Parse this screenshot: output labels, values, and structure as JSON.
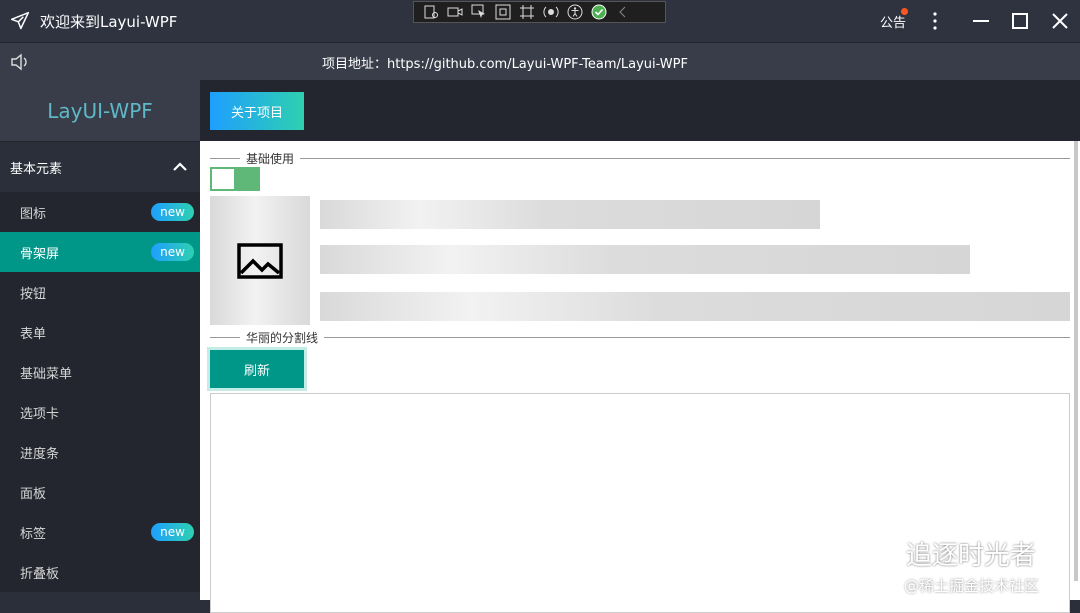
{
  "window": {
    "title": "欢迎来到Layui-WPF",
    "notice_label": "公告"
  },
  "subbar": {
    "address_label": "项目地址：https://github.com/Layui-WPF-Team/Layui-WPF"
  },
  "sidebar": {
    "brand": "LayUI-WPF",
    "group_label": "基本元素",
    "items": [
      {
        "label": "图标",
        "badge": "new"
      },
      {
        "label": "骨架屏",
        "badge": "new"
      },
      {
        "label": "按钮",
        "badge": ""
      },
      {
        "label": "表单",
        "badge": ""
      },
      {
        "label": "基础菜单",
        "badge": ""
      },
      {
        "label": "选项卡",
        "badge": ""
      },
      {
        "label": "进度条",
        "badge": ""
      },
      {
        "label": "面板",
        "badge": ""
      },
      {
        "label": "标签",
        "badge": "new"
      },
      {
        "label": "折叠板",
        "badge": ""
      }
    ]
  },
  "topbar": {
    "about_label": "关于项目"
  },
  "content": {
    "divider1": "基础使用",
    "divider2": "华丽的分割线",
    "refresh_label": "刷新",
    "switch_on": true
  },
  "watermark": {
    "line1": "追逐时光者",
    "line2": "@稀土掘金技术社区"
  },
  "colors": {
    "accent": "#009688",
    "switch": "#5fb878",
    "brand_text": "#5fb8c7",
    "notice_dot": "#ff5722"
  }
}
